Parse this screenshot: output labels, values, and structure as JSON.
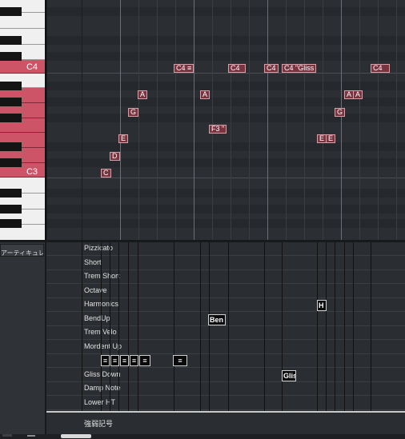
{
  "piano": {
    "c4_label": "C4",
    "c3_label": "C3"
  },
  "notes": [
    {
      "label": "C4",
      "icon": "tremolo-icon",
      "pitch": "C4"
    },
    {
      "label": "C4",
      "pitch": "C4"
    },
    {
      "label": "C4",
      "pitch": "C4"
    },
    {
      "label": "C4",
      "extra": "Gliss",
      "pitch": "C4"
    },
    {
      "label": "C4",
      "pitch": "C4"
    },
    {
      "label": "A",
      "pitch": "A3"
    },
    {
      "label": "A",
      "pitch": "A3"
    },
    {
      "label": "A",
      "pitch": "A3"
    },
    {
      "label": "A",
      "pitch": "A3"
    },
    {
      "label": "G",
      "pitch": "G3"
    },
    {
      "label": "G",
      "pitch": "G3"
    },
    {
      "label": "F3",
      "extra": "\"",
      "pitch": "F3"
    },
    {
      "label": "E",
      "pitch": "E3"
    },
    {
      "label": "E",
      "pitch": "E3"
    },
    {
      "label": "E",
      "pitch": "E3"
    },
    {
      "label": "D",
      "pitch": "D3"
    },
    {
      "label": "C",
      "pitch": "C3"
    }
  ],
  "articulation_panel": {
    "dropdown_label": "アーティキュレーション",
    "lanes": [
      "Pizzicato",
      "Short",
      "Trem Short",
      "Octave",
      "Harmonics",
      "BendUp",
      "Trem Velo",
      "Mordent Up",
      "",
      "Gliss Down",
      "Damp Note",
      "Lower HT"
    ],
    "events": [
      {
        "lane": "Harmonics",
        "label": "H"
      },
      {
        "lane": "BendUp",
        "label": "Ben"
      },
      {
        "lane": "Gliss Down",
        "label": "Glis"
      }
    ],
    "tremolo_glyph": "≡",
    "tremolo_event_count": 5
  },
  "dynamics_lane": {
    "label": "強弱記号"
  },
  "colors": {
    "note_fill": "#7a3440",
    "note_border": "#d6a0a8",
    "highlight_key": "#cc5466",
    "grid_background": "#2b2e32"
  }
}
